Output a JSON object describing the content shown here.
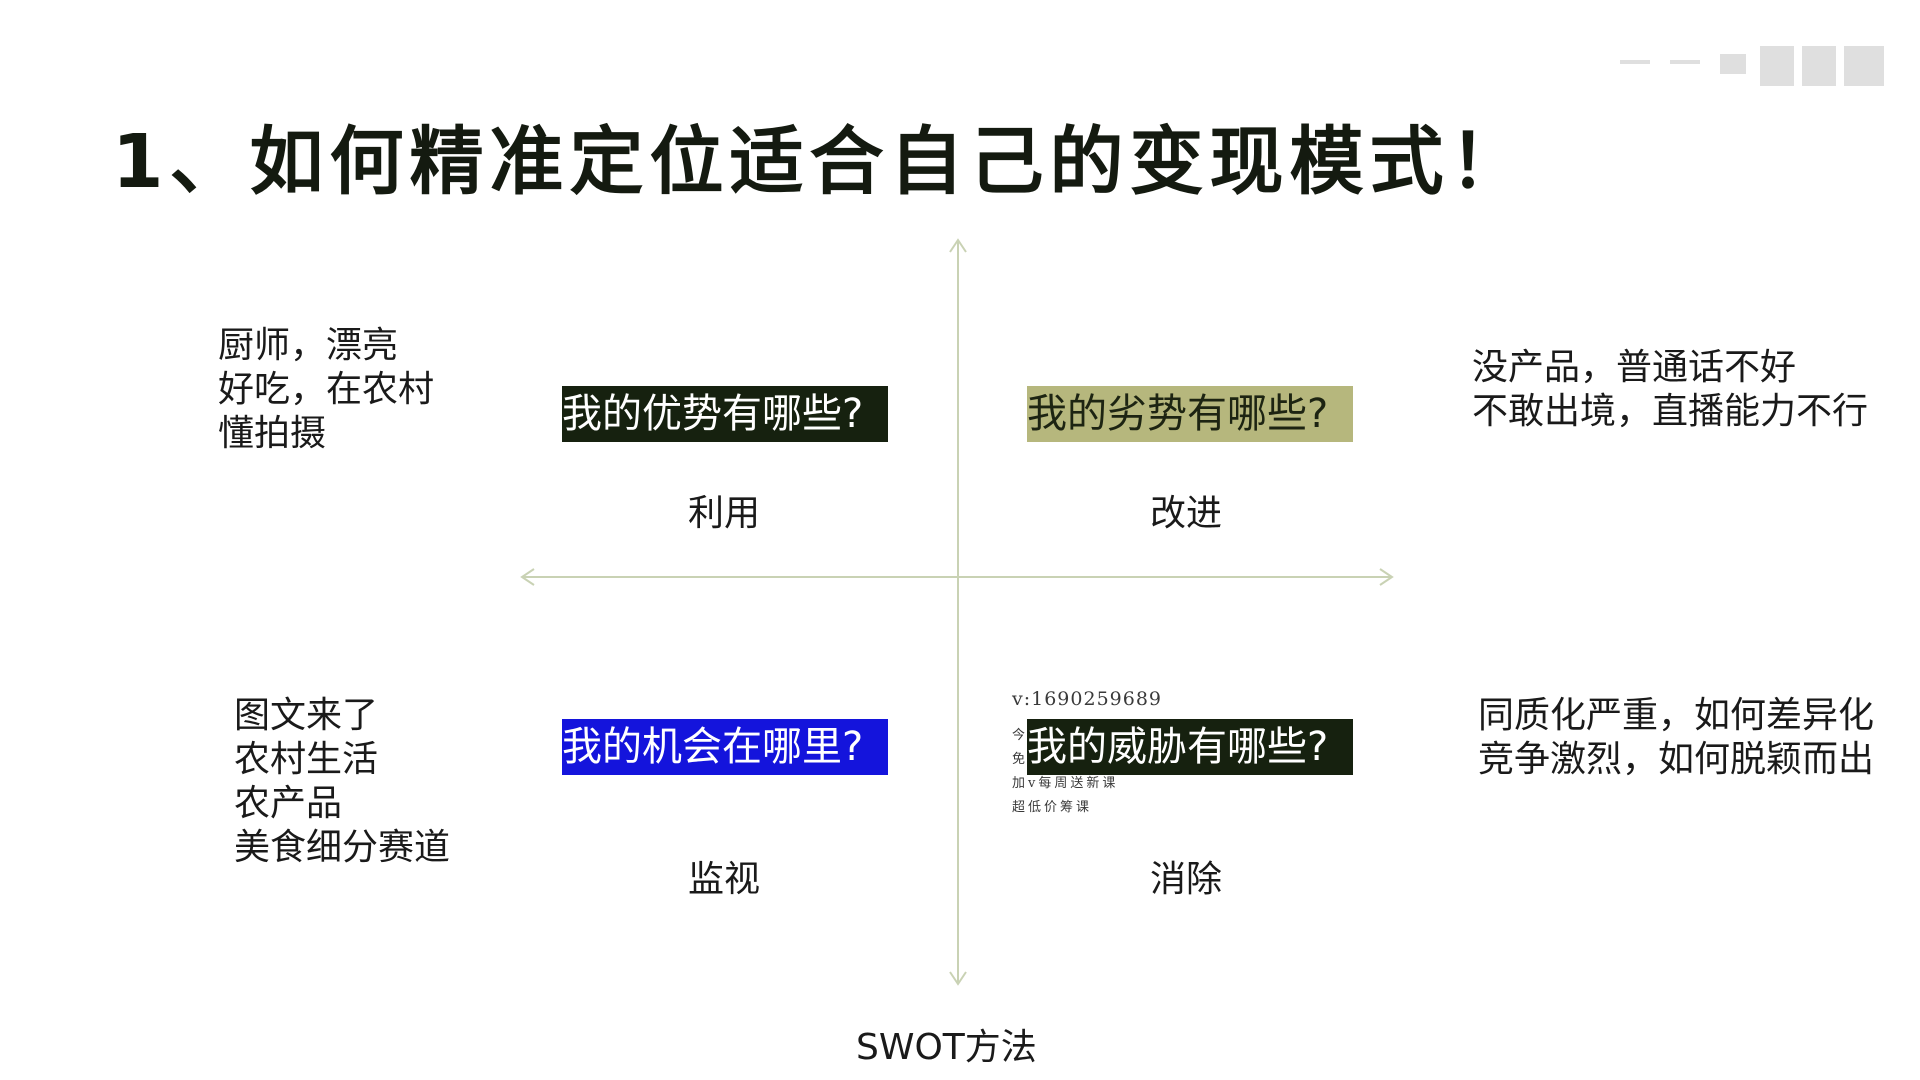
{
  "title": "1、如何精准定位适合自己的变现模式！",
  "quadrants": {
    "strength": {
      "question": "我的优势有哪些?",
      "action": "利用",
      "notes": [
        "厨师，漂亮",
        "好吃，在农村",
        "懂拍摄"
      ],
      "box_color": "#16210f"
    },
    "weakness": {
      "question": "我的劣势有哪些?",
      "action": "改进",
      "notes": [
        "没产品，普通话不好",
        "不敢出境，直播能力不行"
      ],
      "box_color": "#b6b77d"
    },
    "opportunity": {
      "question": "我的机会在哪里?",
      "action": "监视",
      "notes": [
        "图文来了",
        "农村生活",
        "农产品",
        "美食细分赛道"
      ],
      "box_color": "#1414dc"
    },
    "threat": {
      "question": "我的威胁有哪些?",
      "action": "消除",
      "notes": [
        "同质化严重，如何差异化",
        "竞争激烈，如何脱颖而出"
      ],
      "box_color": "#16210f"
    }
  },
  "overlay": {
    "contact": "v:1690259689",
    "lines": [
      "今",
      "免",
      "加v每周送新课",
      "超低价筹课"
    ]
  },
  "footer": "SWOT方法",
  "axis_color": "#c9d2b4"
}
